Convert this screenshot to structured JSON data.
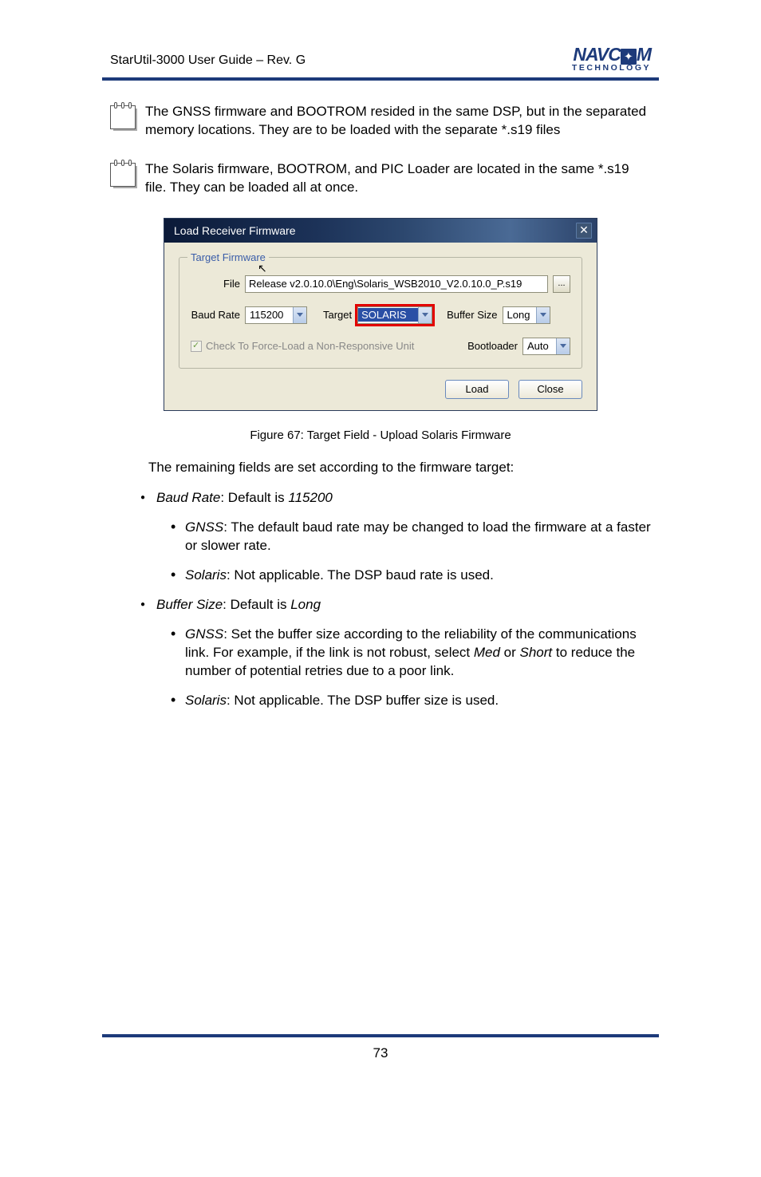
{
  "header": {
    "title": "StarUtil-3000 User Guide – Rev. G",
    "logo_main_pre": "NAVC",
    "logo_main_post": "M",
    "logo_sub": "TECHNOLOGY"
  },
  "notes": [
    "The GNSS firmware and BOOTROM resided in the same DSP, but in the separated memory locations. They are to be loaded with the separate *.s19 files",
    "The Solaris firmware, BOOTROM, and PIC Loader are located in the same *.s19 file. They can be loaded all at once."
  ],
  "dialog": {
    "title": "Load Receiver Firmware",
    "fieldset_legend": "Target Firmware",
    "file_label": "File",
    "file_value": "Release v2.0.10.0\\Eng\\Solaris_WSB2010_V2.0.10.0_P.s19",
    "browse": "...",
    "baud_label": "Baud Rate",
    "baud_value": "115200",
    "target_label": "Target",
    "target_value": "SOLARIS",
    "buffer_label": "Buffer Size",
    "buffer_value": "Long",
    "checkbox_label": "Check To Force-Load a Non-Responsive Unit",
    "bootloader_label": "Bootloader",
    "bootloader_value": "Auto",
    "load_btn": "Load",
    "close_btn": "Close"
  },
  "figure_caption": "Figure 67: Target Field - Upload Solaris Firmware",
  "middle_text": "The remaining fields are set according to the firmware target:",
  "bullets": {
    "b1_lead": "Baud Rate",
    "b1_text": ": Default is ",
    "b1_italic": "115200",
    "b1_1a": "GNSS",
    "b1_1b": ": The default baud rate may be changed to load the firmware at a faster or slower rate.",
    "b1_2a": "Solaris",
    "b1_2b": ": Not applicable. The DSP baud rate is used.",
    "b2_lead": "Buffer Size",
    "b2_text": ": Default is ",
    "b2_italic": "Long",
    "b2_1a": "GNSS",
    "b2_1b": ": Set the buffer size according to the reliability of the communications link. For example, if the link is not robust, select ",
    "b2_1c": "Med",
    "b2_1d": " or ",
    "b2_1e": "Short",
    "b2_1f": " to reduce the number of potential retries due to a poor link.",
    "b2_2a": "Solaris",
    "b2_2b": ": Not applicable. The DSP buffer size is used."
  },
  "page": "73"
}
